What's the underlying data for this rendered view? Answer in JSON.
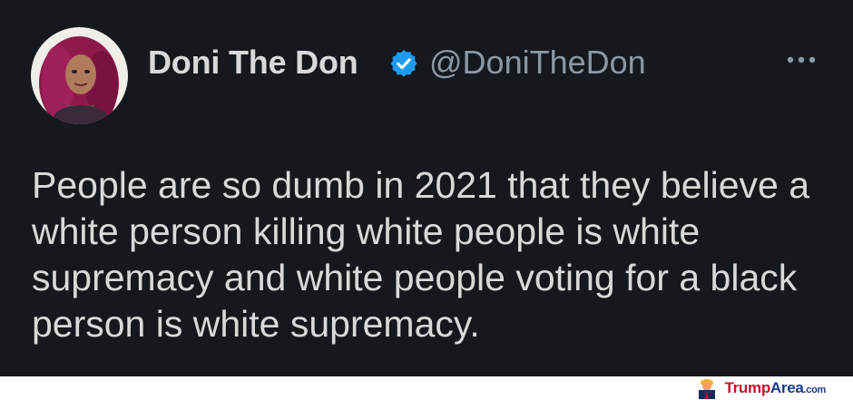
{
  "tweet": {
    "display_name": "Doni The Don",
    "handle": "@DoniTheDon",
    "verified": true,
    "text": "People are so dumb in 2021 that they believe a\nwhite person killing white people is white\nsupremacy and white people voting for a black\nperson is white supremacy.",
    "icons": {
      "verified": "verified-badge-icon",
      "more": "more-options-icon"
    }
  },
  "watermark": {
    "brand_main": "Trump",
    "brand_second": "Area",
    "brand_tld": ".com"
  },
  "colors": {
    "background": "#15181c",
    "primary_text": "#d9d9d9",
    "secondary_text": "#8b98a5",
    "verified_blue": "#1d9bf0"
  }
}
